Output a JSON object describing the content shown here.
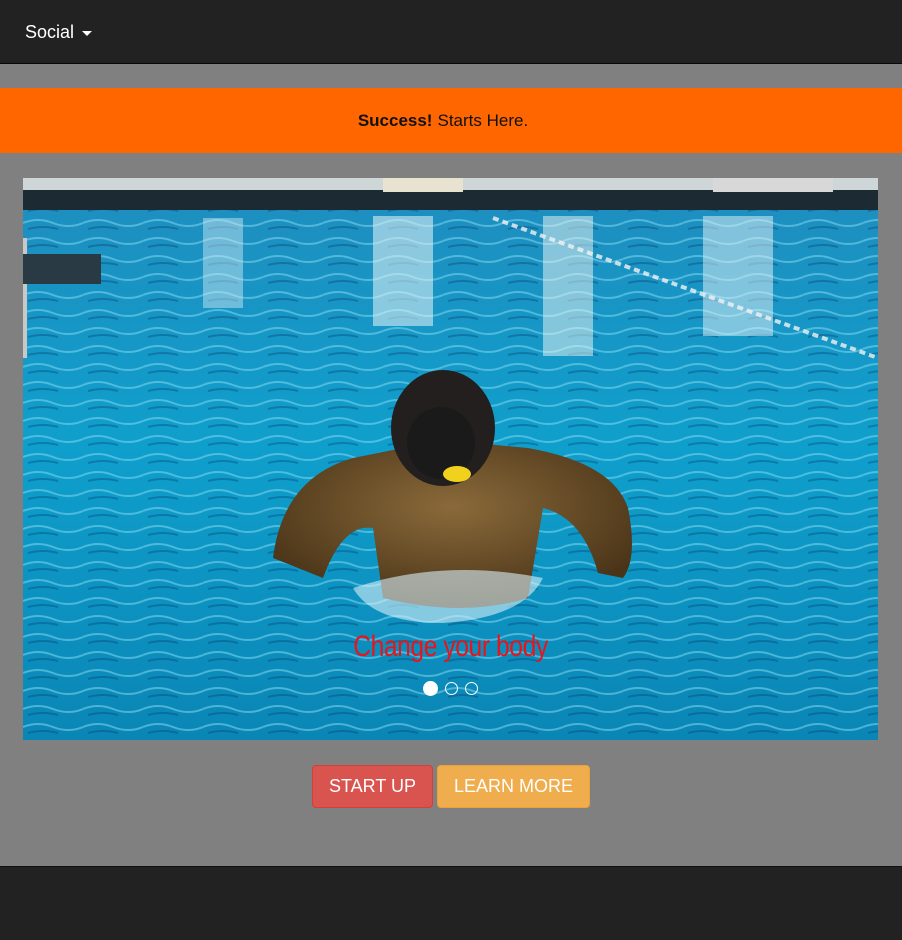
{
  "navbar": {
    "dropdown_label": "Social"
  },
  "alert": {
    "strong": "Success!",
    "text": "Starts Here.",
    "background": "#ff6600"
  },
  "carousel": {
    "caption": "Change your body",
    "caption_color": "#e8141c",
    "slide_count": 3,
    "active_slide": 1,
    "image": "swimmer-with-training-mask-in-pool"
  },
  "buttons": {
    "start_label": "START UP",
    "start_color": "#d9534f",
    "learn_label": "LEARN MORE",
    "learn_color": "#f0ad4e"
  }
}
